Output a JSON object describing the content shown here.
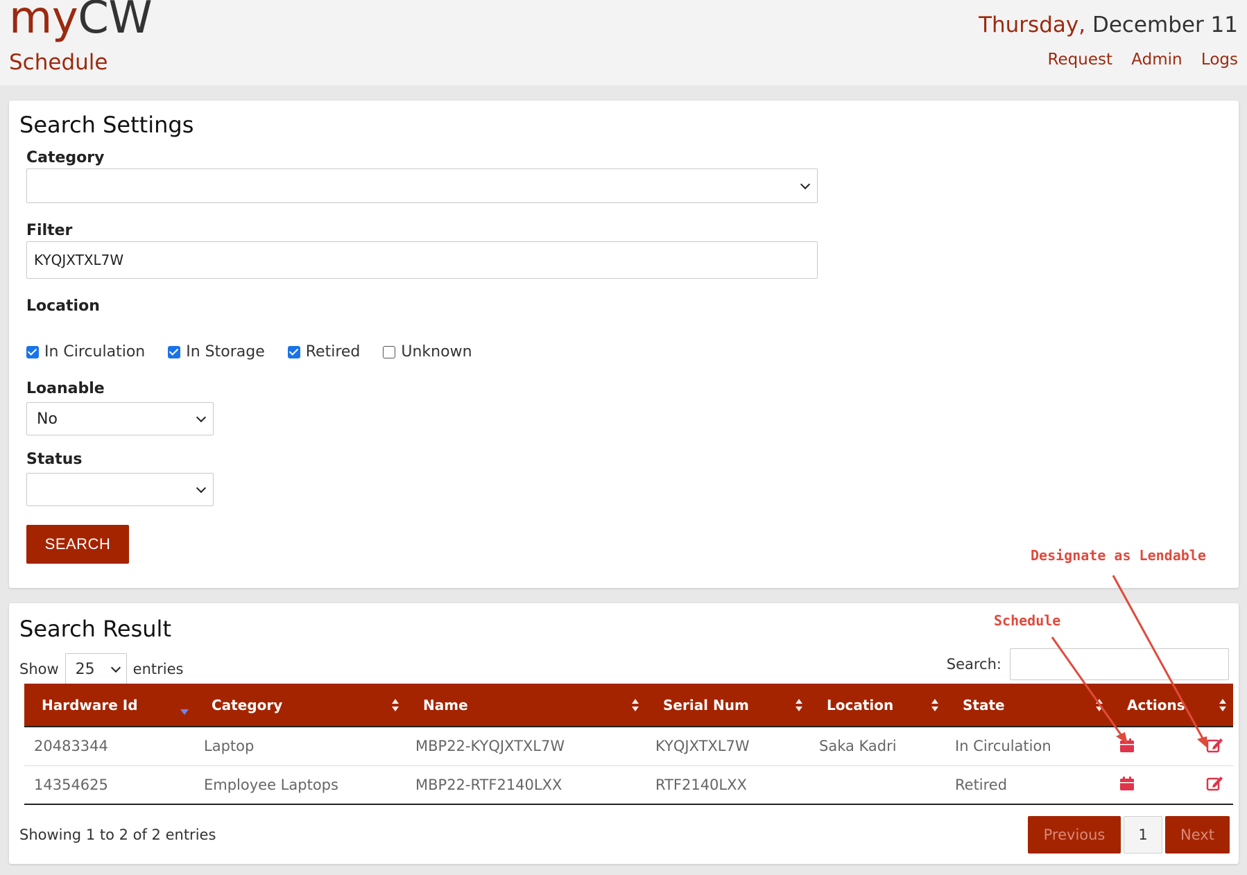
{
  "header": {
    "brand_part1": "my",
    "brand_part2": "CW",
    "subtitle": "Schedule",
    "date_day": "Thursday,",
    "date_rest": " December 11",
    "links": [
      "Request",
      "Admin",
      "Logs"
    ]
  },
  "settings": {
    "title": "Search Settings",
    "category_label": "Category",
    "category_value": "",
    "filter_label": "Filter",
    "filter_value": "KYQJXTXL7W",
    "location_label": "Location",
    "locations": [
      {
        "label": "In Circulation",
        "checked": true
      },
      {
        "label": "In Storage",
        "checked": true
      },
      {
        "label": "Retired",
        "checked": true
      },
      {
        "label": "Unknown",
        "checked": false
      }
    ],
    "loanable_label": "Loanable",
    "loanable_value": "No",
    "status_label": "Status",
    "status_value": "",
    "search_button": "SEARCH"
  },
  "results": {
    "title": "Search Result",
    "show_label": "Show",
    "page_size": "25",
    "entries_label": "entries",
    "search_label": "Search:",
    "search_value": "",
    "columns": [
      "Hardware Id",
      "Category",
      "Name",
      "Serial Num",
      "Location",
      "State",
      "Actions"
    ],
    "rows": [
      {
        "hardware_id": "20483344",
        "category": "Laptop",
        "name": "MBP22-KYQJXTXL7W",
        "serial": "KYQJXTXL7W",
        "location": "Saka Kadri",
        "state": "In Circulation"
      },
      {
        "hardware_id": "14354625",
        "category": "Employee Laptops",
        "name": "MBP22-RTF2140LXX",
        "serial": "RTF2140LXX",
        "location": "",
        "state": "Retired"
      }
    ],
    "summary": "Showing 1 to 2 of 2 entries",
    "pager": {
      "previous": "Previous",
      "page": "1",
      "next": "Next"
    }
  },
  "annotations": {
    "lendable": "Designate as Lendable",
    "schedule": "Schedule"
  },
  "colors": {
    "brand": "#9b2a10",
    "header_row": "#a42400",
    "action_icon": "#e0344a",
    "annotation": "#e04a3c"
  }
}
